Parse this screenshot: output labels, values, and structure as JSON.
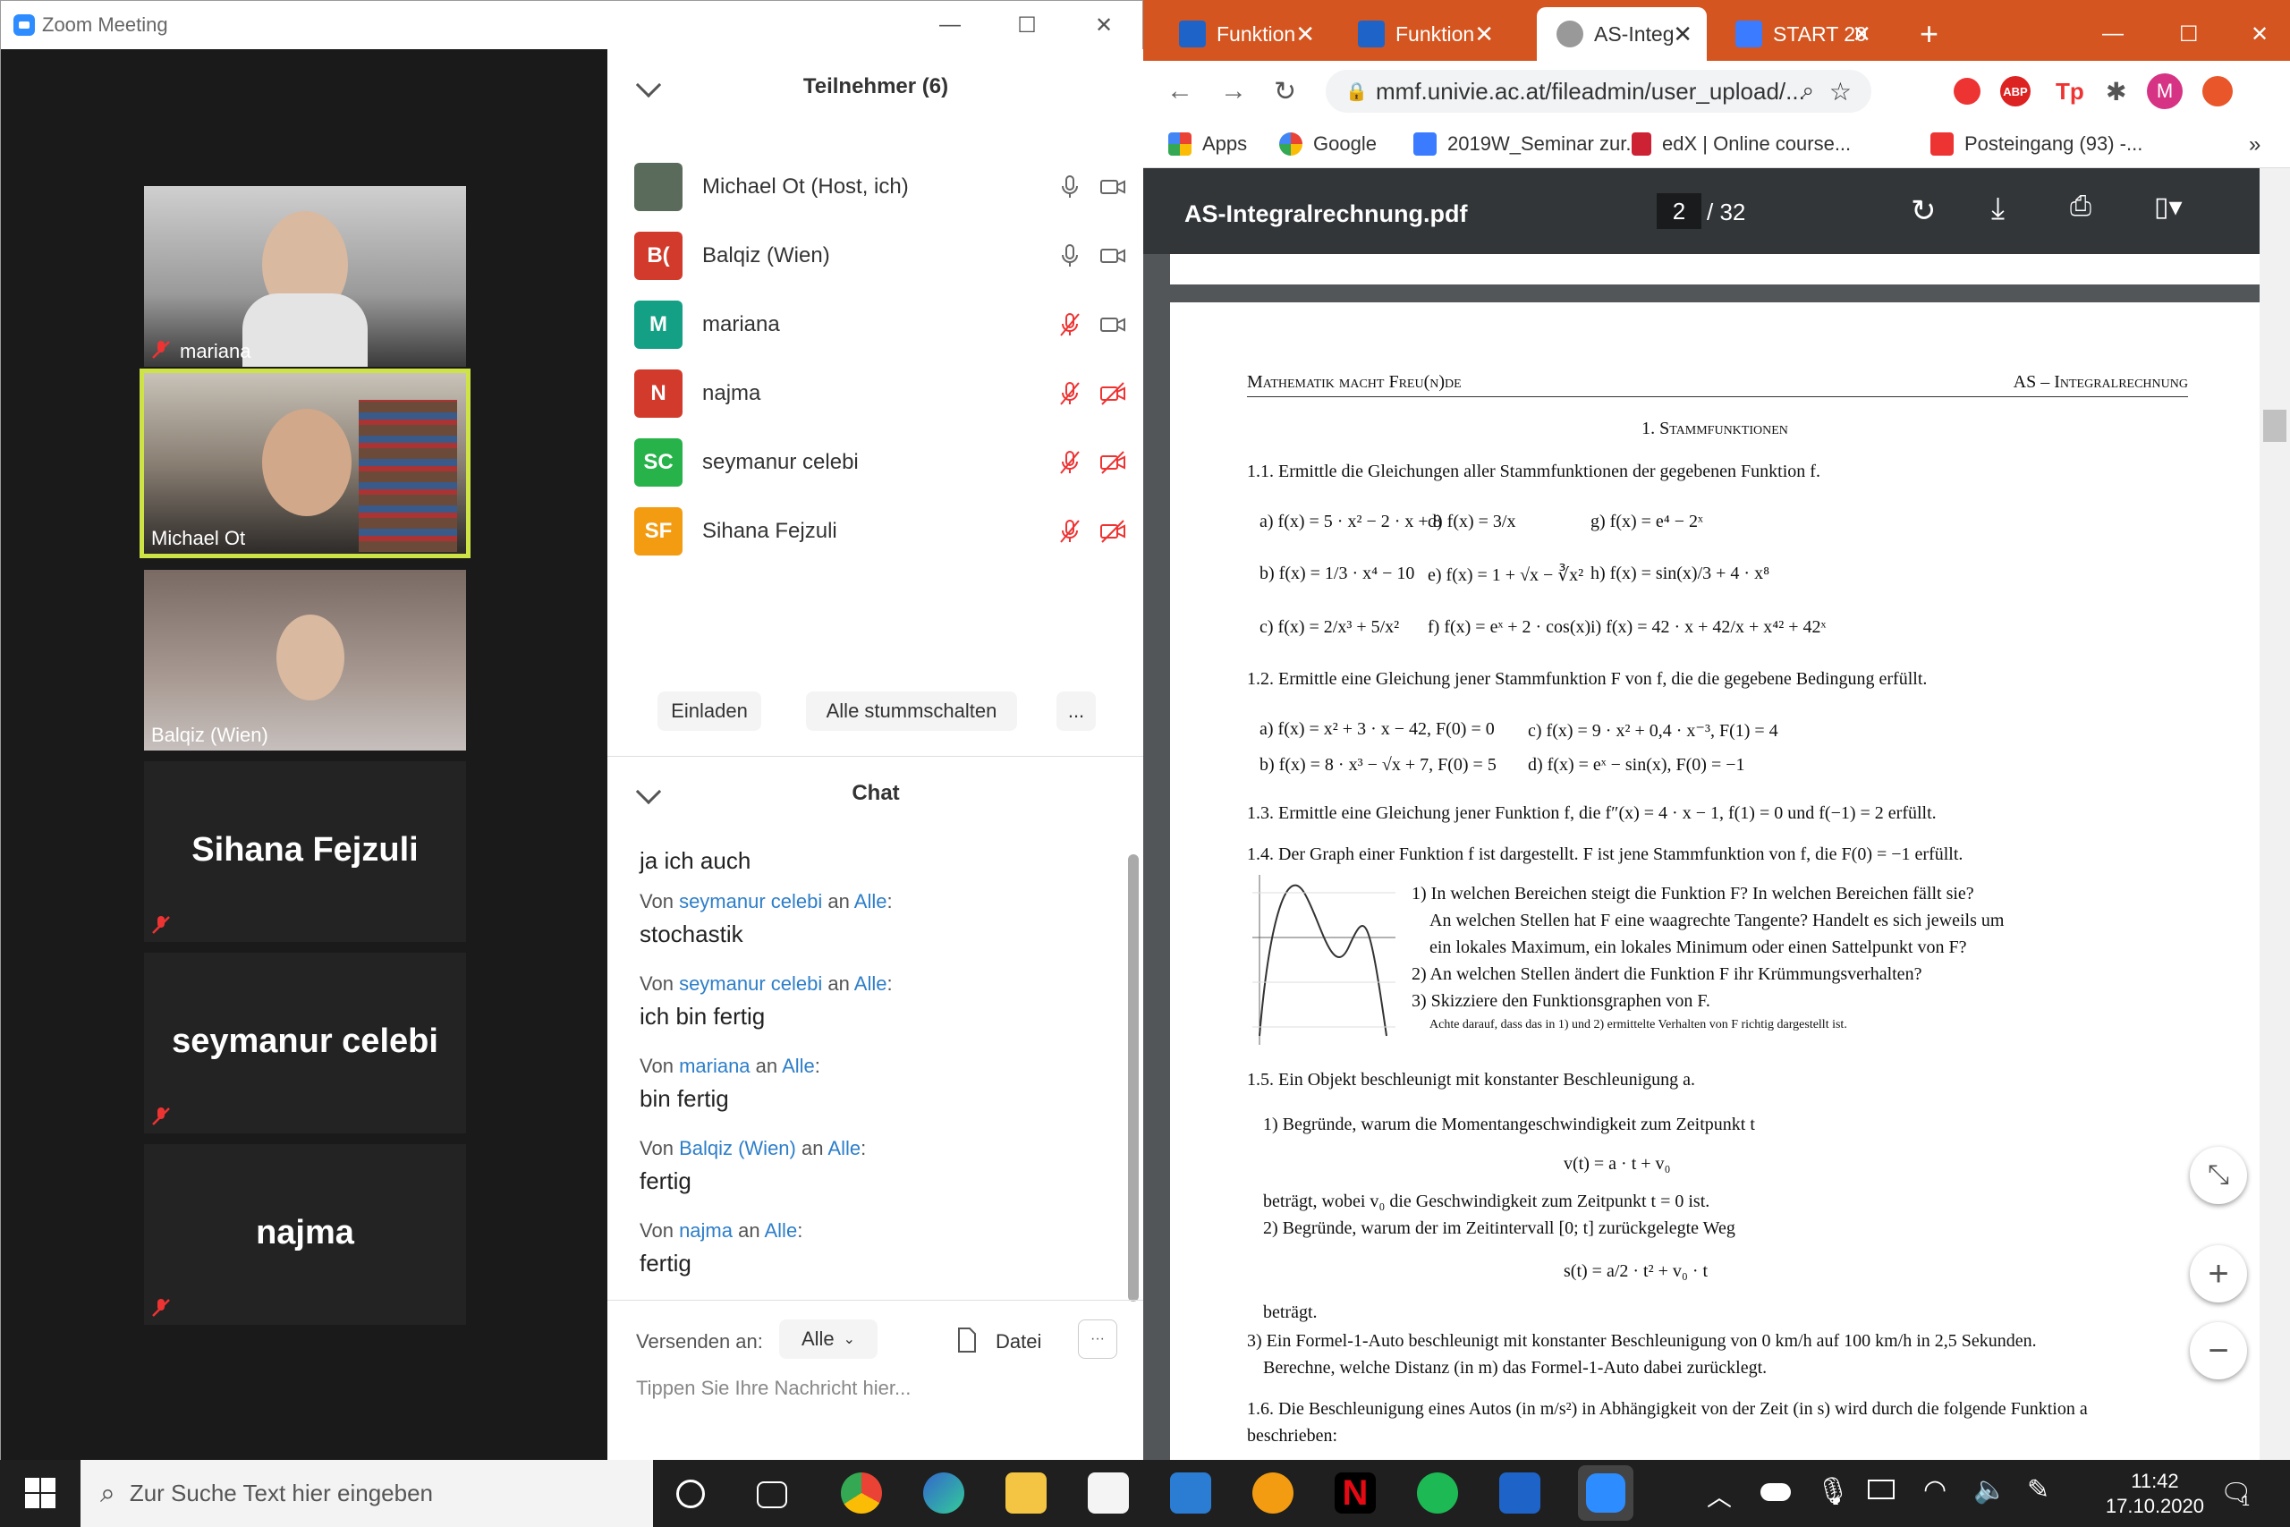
{
  "zoom": {
    "title": "Zoom Meeting",
    "tiles": [
      {
        "name": "mariana"
      },
      {
        "name": "Michael Ot"
      },
      {
        "name": "Balqiz (Wien)"
      },
      {
        "name": "Sihana Fejzuli"
      },
      {
        "name": "seymanur celebi"
      },
      {
        "name": "najma"
      }
    ],
    "participants_title": "Teilnehmer (6)",
    "participants": [
      {
        "initials": "",
        "name": "Michael Ot (Host, ich)",
        "color": "#5b6b5b",
        "mic": "on",
        "cam": "on"
      },
      {
        "initials": "B(",
        "name": "Balqiz (Wien)",
        "color": "#d23b2c",
        "mic": "on",
        "cam": "on"
      },
      {
        "initials": "M",
        "name": "mariana",
        "color": "#13a085",
        "mic": "muted",
        "cam": "on"
      },
      {
        "initials": "N",
        "name": "najma",
        "color": "#d23b2c",
        "mic": "muted",
        "cam": "off"
      },
      {
        "initials": "SC",
        "name": "seymanur celebi",
        "color": "#27b24a",
        "mic": "muted",
        "cam": "off"
      },
      {
        "initials": "SF",
        "name": "Sihana Fejzuli",
        "color": "#f39c12",
        "mic": "muted",
        "cam": "off"
      }
    ],
    "invite_label": "Einladen",
    "mute_all_label": "Alle stummschalten",
    "more_label": "...",
    "chat_title": "Chat",
    "chat_first": "ja ich auch",
    "messages": [
      {
        "from": "seymanur celebi",
        "to": "Alle",
        "text": "stochastik"
      },
      {
        "from": "seymanur celebi",
        "to": "Alle",
        "text": "ich bin fertig"
      },
      {
        "from": "mariana",
        "to": "Alle",
        "text": "bin fertig"
      },
      {
        "from": "Balqiz (Wien)",
        "to": "Alle",
        "text": "fertig"
      },
      {
        "from": "najma",
        "to": "Alle",
        "text": "fertig"
      }
    ],
    "von": "Von",
    "an": "an",
    "send_to_label": "Versenden an:",
    "send_to_value": "Alle",
    "file_label": "Datei",
    "chat_placeholder": "Tippen Sie Ihre Nachricht hier..."
  },
  "browser": {
    "tabs": [
      {
        "label": "Funktion",
        "color": "#1e64c8"
      },
      {
        "label": "Funktion",
        "color": "#1e64c8"
      },
      {
        "label": "AS-Integ",
        "color": "#777"
      },
      {
        "label": "START 20",
        "color": "#1e64c8"
      }
    ],
    "url": "mmf.univie.ac.at/fileadmin/user_upload/...",
    "bookmarks": [
      "Apps",
      "Google",
      "2019W_Seminar zur...",
      "edX | Online course...",
      "Posteingang (93) -..."
    ],
    "pdf_name": "AS-Integralrechnung.pdf",
    "page_current": "2",
    "page_total": "/ 32",
    "doc": {
      "header_left": "Mathematik macht Freu(n)de",
      "header_right": "AS – Integralrechnung",
      "section": "1. Stammfunktionen",
      "lines": [
        "1.1.  Ermittle die Gleichungen aller Stammfunktionen der gegebenen Funktion f.",
        "a)  f(x) = 5 · x² − 2 · x + 8",
        "d)  f(x) = 3/x",
        "g)  f(x) = e⁴ − 2ˣ",
        "b)  f(x) = 1/3 · x⁴ − 10",
        "e)  f(x) = 1 + √x − ∛x²",
        "h)  f(x) = sin(x)/3 + 4 · x⁸",
        "c)  f(x) = 2/x³ + 5/x²",
        "f)  f(x) = eˣ + 2 · cos(x)",
        "i)  f(x) = 42 · x + 42/x + x⁴² + 42ˣ",
        "1.2.  Ermittle eine Gleichung jener Stammfunktion F von f, die die gegebene Bedingung erfüllt.",
        "a)  f(x) = x² + 3 · x − 42,    F(0) = 0",
        "c)  f(x) = 9 · x² + 0,4 · x⁻³,   F(1) = 4",
        "b)  f(x) = 8 · x³ − √x + 7,   F(0) = 5",
        "d)  f(x) = eˣ − sin(x),          F(0) = −1",
        "1.3.  Ermittle eine Gleichung jener Funktion f, die f″(x) = 4 · x − 1,  f(1) = 0 und f(−1) = 2 erfüllt.",
        "1.4.  Der Graph einer Funktion f ist dargestellt. F ist jene Stammfunktion von f, die F(0) = −1 erfüllt.",
        "1)  In welchen Bereichen steigt die Funktion F? In welchen Bereichen fällt sie?",
        "An welchen Stellen hat F eine waagrechte Tangente? Handelt es sich jeweils um",
        "ein lokales Maximum, ein lokales Minimum oder einen Sattelpunkt von F?",
        "2)  An welchen Stellen ändert die Funktion F ihr Krümmungsverhalten?",
        "3)  Skizziere den Funktionsgraphen von F.",
        "Achte darauf, dass das in 1) und 2) ermittelte Verhalten von F richtig dargestellt ist.",
        "1.5.  Ein Objekt beschleunigt mit konstanter Beschleunigung a.",
        "1)  Begründe, warum die Momentangeschwindigkeit zum Zeitpunkt t",
        "v(t) = a · t + v₀",
        "beträgt, wobei v₀ die Geschwindigkeit zum Zeitpunkt t = 0 ist.",
        "2)  Begründe, warum der im Zeitintervall [0; t] zurückgelegte Weg",
        "s(t) = a/2 · t² + v₀ · t",
        "beträgt.",
        "3)  Ein Formel-1-Auto beschleunigt mit konstanter Beschleunigung von 0 km/h auf 100 km/h in 2,5 Sekunden.",
        "Berechne, welche Distanz (in m) das Formel-1-Auto dabei zurücklegt.",
        "1.6.  Die Beschleunigung eines Autos (in m/s²) in Abhängigkeit von der Zeit (in s) wird durch die folgende Funktion a",
        "beschrieben:"
      ]
    }
  },
  "taskbar": {
    "search_placeholder": "Zur Suche Text hier eingeben",
    "time": "11:42",
    "date": "17.10.2020",
    "notif_count": "1"
  }
}
